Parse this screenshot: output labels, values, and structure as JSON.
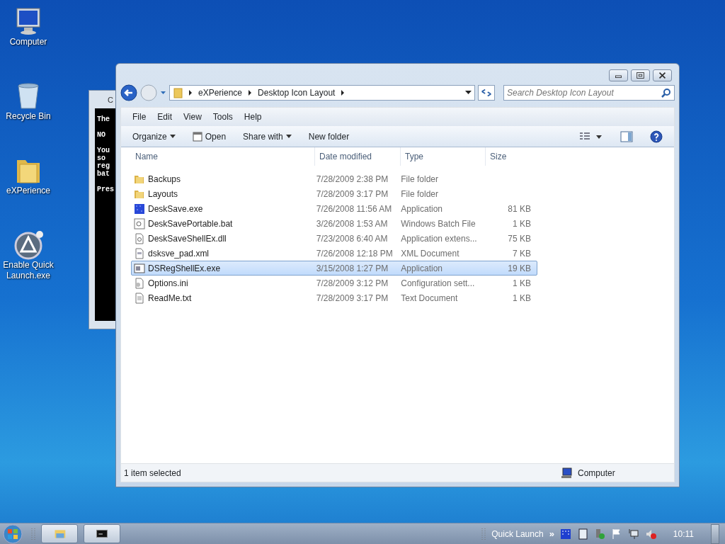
{
  "desktop_icons": [
    {
      "kind": "computer",
      "label": "Computer"
    },
    {
      "kind": "recycle",
      "label": "Recycle Bin"
    },
    {
      "kind": "folder",
      "label": "eXPerience"
    },
    {
      "kind": "app",
      "label": "Enable Quick Launch.exe"
    }
  ],
  "console": {
    "title": "C",
    "paragraphs": [
      [
        "The"
      ],
      [
        "NO"
      ],
      [
        "You",
        "so",
        "reg",
        "bat"
      ],
      [
        "Pres"
      ]
    ]
  },
  "explorer": {
    "breadcrumb": [
      "eXPerience",
      "Desktop Icon Layout"
    ],
    "search": {
      "placeholder": "Search Desktop Icon Layout"
    },
    "menu": [
      "File",
      "Edit",
      "View",
      "Tools",
      "Help"
    ],
    "toolbar": [
      {
        "kind": "dropdown",
        "label": "Organize"
      },
      {
        "kind": "open",
        "label": "Open"
      },
      {
        "kind": "dropdown",
        "label": "Share with"
      },
      {
        "kind": "plain",
        "label": "New folder"
      }
    ],
    "columns": [
      "Name",
      "Date modified",
      "Type",
      "Size"
    ],
    "rows": [
      {
        "kind": "folder",
        "name": "Backups",
        "date": "7/28/2009 2:38 PM",
        "type": "File folder",
        "selected": false
      },
      {
        "kind": "folder",
        "name": "Layouts",
        "date": "7/28/2009 3:17 PM",
        "type": "File folder",
        "selected": false
      },
      {
        "kind": "exe",
        "name": "DeskSave.exe",
        "date": "7/26/2008 11:56 AM",
        "type": "Application",
        "size": "81 KB",
        "selected": false
      },
      {
        "kind": "bat",
        "name": "DeskSavePortable.bat",
        "date": "3/26/2008 1:53 AM",
        "type": "Windows Batch File",
        "size": "1 KB",
        "selected": false
      },
      {
        "kind": "dll",
        "name": "DeskSaveShellEx.dll",
        "date": "7/23/2008 6:40 AM",
        "type": "Application extens...",
        "size": "75 KB",
        "selected": false
      },
      {
        "kind": "xml",
        "name": "dsksve_pad.xml",
        "date": "7/26/2008 12:18 PM",
        "type": "XML Document",
        "size": "7 KB",
        "selected": false
      },
      {
        "kind": "window",
        "name": "DSRegShellEx.exe",
        "date": "3/15/2008 1:27 PM",
        "type": "Application",
        "size": "19 KB",
        "selected": true
      },
      {
        "kind": "ini",
        "name": "Options.ini",
        "date": "7/28/2009 3:12 PM",
        "type": "Configuration sett...",
        "size": "1 KB",
        "selected": false
      },
      {
        "kind": "txt",
        "name": "ReadMe.txt",
        "date": "7/28/2009 3:17 PM",
        "type": "Text Document",
        "size": "1 KB",
        "selected": false
      }
    ],
    "status_left": "1 item selected",
    "status_right": "Computer"
  },
  "taskbar": {
    "quick_launch": "Quick Launch",
    "overflow": "»",
    "clock": "10:11"
  }
}
